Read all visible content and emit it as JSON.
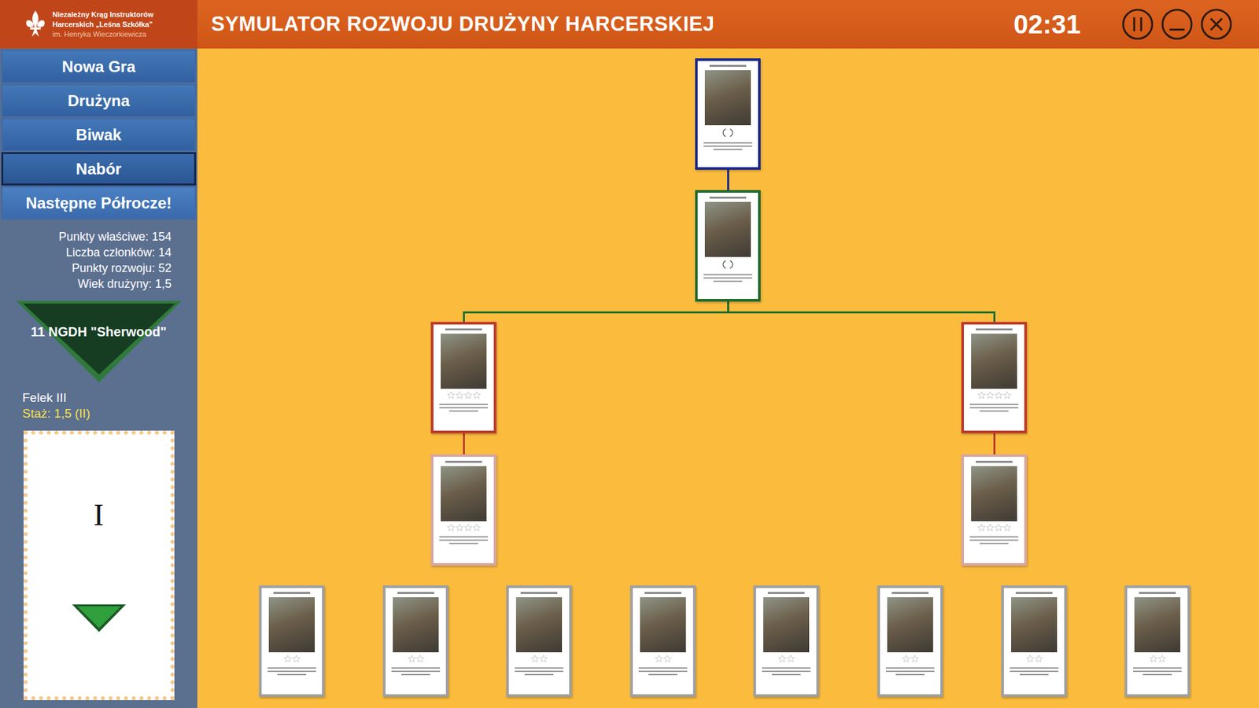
{
  "header": {
    "logo_lines": [
      "Niezależny Krąg Instruktorów",
      "Harcerskich „Leśna Szkółka”",
      "im. Henryka Wieczorkiewicza"
    ],
    "title": "SYMULATOR ROZWOJU DRUŻYNY HARCERSKIEJ",
    "timer": "02:31"
  },
  "menu": [
    {
      "label": "Nowa Gra",
      "selected": false
    },
    {
      "label": "Drużyna",
      "selected": false
    },
    {
      "label": "Biwak",
      "selected": false
    },
    {
      "label": "Nabór",
      "selected": true
    },
    {
      "label": "Następne Półrocze!",
      "selected": false
    }
  ],
  "stats": [
    "Punkty właściwe: 154",
    "Liczba członków: 14",
    "Punkty rozwoju: 52",
    "Wiek drużyny: 1,5"
  ],
  "team_name": "11 NGDH \"Sherwood\"",
  "member": {
    "name": "Felek III",
    "tenure": "Staż: 1,5 (II)",
    "card_rank": "I"
  },
  "tree": [
    {
      "kind": "laurel",
      "color": "#1b2a8c",
      "parent": null,
      "stars": 0,
      "max_stars": 0
    },
    {
      "kind": "laurel",
      "color": "#1f6b2f",
      "parent": 0,
      "stars": 0,
      "max_stars": 0
    },
    {
      "kind": "stars",
      "color": "#c0392b",
      "parent": 1,
      "stars": 0,
      "max_stars": 4
    },
    {
      "kind": "stars",
      "color": "#c0392b",
      "parent": 1,
      "stars": 0,
      "max_stars": 4
    },
    {
      "kind": "stars",
      "color": "#d8a7a2",
      "parent": 2,
      "stars": 0,
      "max_stars": 4
    },
    {
      "kind": "stars",
      "color": "#d8a7a2",
      "parent": 3,
      "stars": 0,
      "max_stars": 4
    },
    {
      "kind": "stars",
      "color": "#a0a0a0",
      "parent": null,
      "stars": 0,
      "max_stars": 2
    },
    {
      "kind": "stars",
      "color": "#a0a0a0",
      "parent": null,
      "stars": 0,
      "max_stars": 2
    },
    {
      "kind": "stars",
      "color": "#a0a0a0",
      "parent": null,
      "stars": 0,
      "max_stars": 2
    },
    {
      "kind": "stars",
      "color": "#a0a0a0",
      "parent": null,
      "stars": 0,
      "max_stars": 2
    },
    {
      "kind": "stars",
      "color": "#a0a0a0",
      "parent": null,
      "stars": 0,
      "max_stars": 2
    },
    {
      "kind": "stars",
      "color": "#a0a0a0",
      "parent": null,
      "stars": 0,
      "max_stars": 2
    },
    {
      "kind": "stars",
      "color": "#a0a0a0",
      "parent": null,
      "stars": 0,
      "max_stars": 2
    },
    {
      "kind": "stars",
      "color": "#a0a0a0",
      "parent": null,
      "stars": 0,
      "max_stars": 2
    }
  ]
}
